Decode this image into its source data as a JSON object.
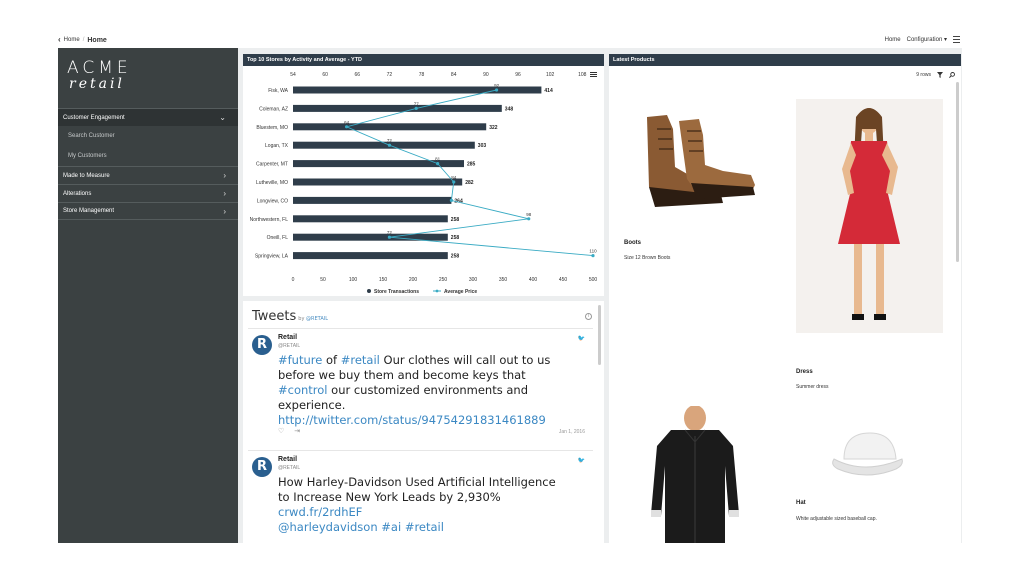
{
  "breadcrumb": {
    "back_label": "Home",
    "current": "Home"
  },
  "topbar": {
    "home_label": "Home",
    "config_label": "Configuration ▾"
  },
  "logo": {
    "line1": "ACME",
    "line2": "retail"
  },
  "nav": {
    "engagement": "Customer Engagement",
    "search_customer": "Search Customer",
    "my_customers": "My Customers",
    "made_to_measure": "Made to Measure",
    "alterations": "Alterations",
    "store_management": "Store Management"
  },
  "chart_panel": {
    "title": "Top 10 Stores by Activity and Average - YTD"
  },
  "chart_data": {
    "type": "bar",
    "title": "Top 10 Stores by Activity and Average - YTD",
    "categories": [
      "Fisk, WA",
      "Coleman, AZ",
      "Bluestem, MO",
      "Logan, TX",
      "Carpenter, MT",
      "Lutheville, MO",
      "Longview, CO",
      "Northwestern, FL",
      "Oneill, FL",
      "Springview, LA"
    ],
    "series": [
      {
        "name": "Store Transactions",
        "values": [
          414,
          348,
          322,
          303,
          285,
          282,
          264,
          258,
          258,
          258
        ],
        "color": "#2f3d4a"
      },
      {
        "name": "Average Price",
        "values": [
          92,
          77,
          64,
          72,
          81,
          84,
          0,
          98,
          72,
          110
        ],
        "color": "#3aabc4"
      }
    ],
    "bottom_axis": {
      "ticks": [
        0,
        50,
        100,
        150,
        200,
        250,
        300,
        350,
        400,
        450,
        500
      ],
      "range": [
        0,
        500
      ]
    },
    "top_axis": {
      "ticks": [
        54,
        60,
        66,
        72,
        78,
        84,
        90,
        96,
        102,
        108
      ],
      "range": [
        54,
        110
      ]
    },
    "legend": "bottom"
  },
  "tweets": {
    "title": "Tweets",
    "by": "by",
    "by_handle": "@RETAIL",
    "items": [
      {
        "name": "Retail",
        "handle": "@RETAIL",
        "t1": "#future",
        "t2": " of ",
        "t3": "#retail",
        "t4": " Our clothes will call out to us before we buy them and become keys that ",
        "t5": "#control",
        "t6": " our customized environments and experience. ",
        "t7": "http://twitter.com/status/94754291831461889",
        "date": "Jan 1, 2016"
      },
      {
        "name": "Retail",
        "handle": "@RETAIL",
        "t1": "How Harley-Davidson Used Artificial Intelligence to Increase New York Leads by 2,930% ",
        "t2": "crwd.fr/2rdhEF",
        "t3": "@harleydavidson",
        "t4": " ",
        "t5": "#ai",
        "t6": " ",
        "t7": "#retail"
      }
    ]
  },
  "products": {
    "title": "Latest Products",
    "rows": "9 rows",
    "items": [
      {
        "name": "Boots",
        "desc": "Size 12 Brown Boots"
      },
      {
        "name": "Dress",
        "desc": "Summer dress"
      },
      {
        "name": "Hat",
        "desc": "White adjustable sized baseball cap."
      }
    ]
  },
  "colors": {
    "sidebar": "#3b4142",
    "header": "#2f3d4a",
    "accent": "#3aabc4",
    "link": "#3b88c3"
  }
}
